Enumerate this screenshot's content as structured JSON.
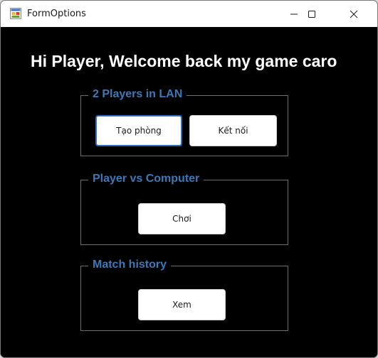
{
  "window": {
    "title": "FormOptions",
    "icon": "winforms-app-icon"
  },
  "caption_buttons": {
    "minimize_icon": "minimize-icon",
    "maximize_icon": "maximize-icon",
    "close_icon": "close-icon"
  },
  "welcome_text": "Hi Player, Welcome back my game caro",
  "groups": {
    "lan": {
      "legend": "2 Players in LAN",
      "create_room_label": "Tạo phòng",
      "connect_label": "Kết nối"
    },
    "pvc": {
      "legend": "Player vs Computer",
      "play_label": "Chơi"
    },
    "history": {
      "legend": "Match history",
      "view_label": "Xem"
    }
  },
  "colors": {
    "background": "#000000",
    "legend_text": "#3b79b8",
    "welcome_text": "#ffffff",
    "focus_border": "#2f6fba"
  }
}
